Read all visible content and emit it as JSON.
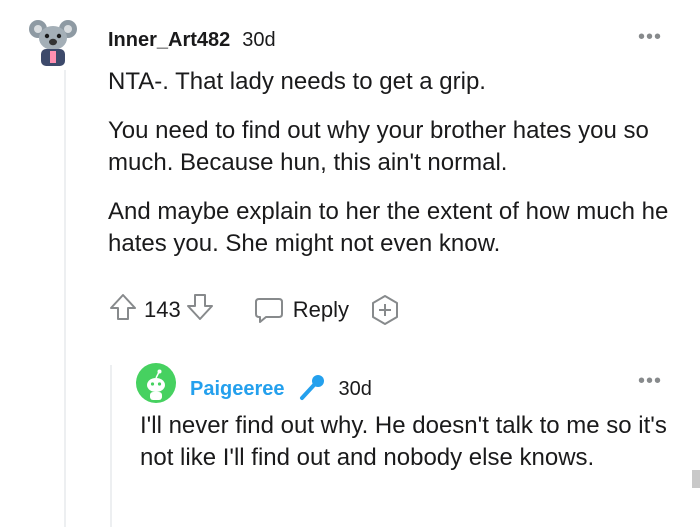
{
  "comment": {
    "username": "Inner_Art482",
    "time": "30d",
    "more_label": "•••",
    "paragraphs": [
      "NTA-. That lady needs to get a grip.",
      "You need to find out why your brother hates you so much. Because hun, this ain't normal.",
      "And maybe explain to her the extent of how much he hates you. She might not even know."
    ],
    "votes": "143",
    "reply_label": "Reply",
    "icons": {
      "upvote": "upvote-icon",
      "downvote": "downvote-icon",
      "reply": "reply-bubble-icon",
      "award": "award-icon",
      "avatar": "koala-avatar"
    }
  },
  "reply": {
    "username": "Paigeeree",
    "time": "30d",
    "more_label": "•••",
    "text": "I'll never find out why. He doesn't talk to me so it's not like I'll find out and nobody else knows.",
    "icons": {
      "flair": "microphone-icon",
      "avatar": "snoo-avatar"
    }
  },
  "colors": {
    "username_reply": "#24a0ed",
    "avatar_reply_bg": "#46d160",
    "thread_line": "#edeff1",
    "muted": "#878a8c"
  }
}
